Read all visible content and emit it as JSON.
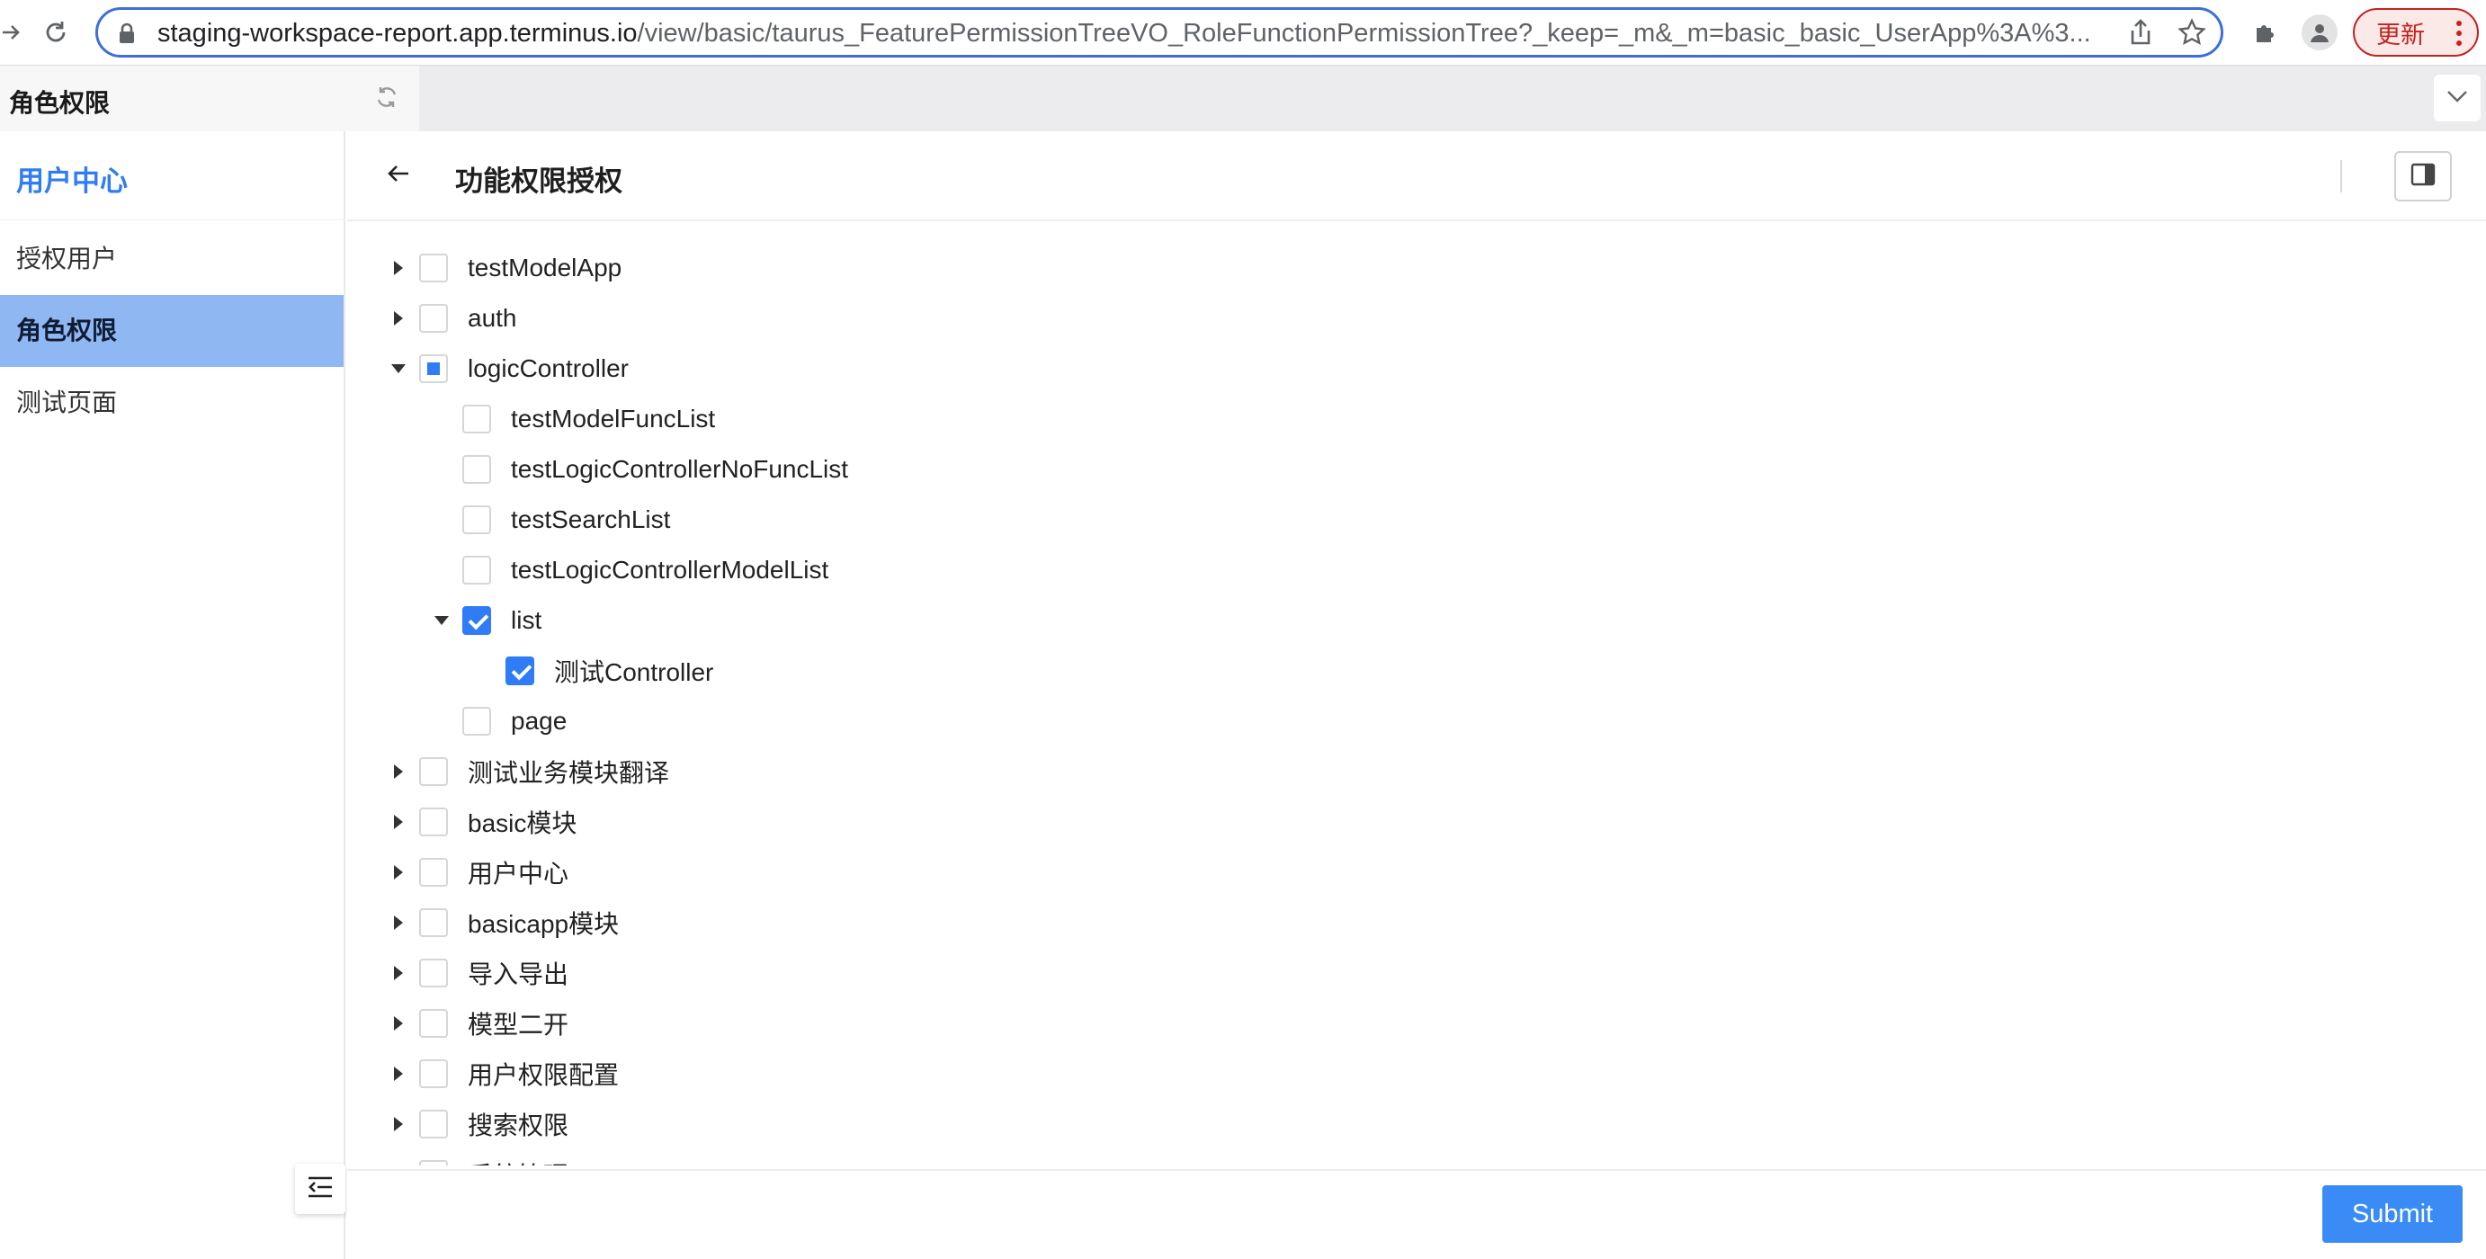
{
  "browser": {
    "url_host": "staging-workspace-report.app.terminus.io",
    "url_path": "/view/basic/taurus_FeaturePermissionTreeVO_RoleFunctionPermissionTree?_keep=_m&_m=basic_basic_UserApp%3A%3...",
    "update_label": "更新"
  },
  "tab": {
    "title": "角色权限"
  },
  "sidebar": {
    "title": "用户中心",
    "items": [
      {
        "label": "授权用户",
        "active": false
      },
      {
        "label": "角色权限",
        "active": true
      },
      {
        "label": "测试页面",
        "active": false
      }
    ]
  },
  "page": {
    "title": "功能权限授权"
  },
  "tree": [
    {
      "label": "testModelApp",
      "level": 0,
      "expand": "collapsed",
      "check": "none"
    },
    {
      "label": "auth",
      "level": 0,
      "expand": "collapsed",
      "check": "none"
    },
    {
      "label": "logicController",
      "level": 0,
      "expand": "expanded",
      "check": "half"
    },
    {
      "label": "testModelFuncList",
      "level": 1,
      "expand": "leaf",
      "check": "none"
    },
    {
      "label": "testLogicControllerNoFuncList",
      "level": 1,
      "expand": "leaf",
      "check": "none"
    },
    {
      "label": "testSearchList",
      "level": 1,
      "expand": "leaf",
      "check": "none"
    },
    {
      "label": "testLogicControllerModelList",
      "level": 1,
      "expand": "leaf",
      "check": "none"
    },
    {
      "label": "list",
      "level": 1,
      "expand": "expanded",
      "check": "checked"
    },
    {
      "label": "测试Controller",
      "level": 2,
      "expand": "leaf",
      "check": "checked"
    },
    {
      "label": "page",
      "level": 1,
      "expand": "leaf",
      "check": "none"
    },
    {
      "label": "测试业务模块翻译",
      "level": 0,
      "expand": "collapsed",
      "check": "none"
    },
    {
      "label": "basic模块",
      "level": 0,
      "expand": "collapsed",
      "check": "none"
    },
    {
      "label": "用户中心",
      "level": 0,
      "expand": "collapsed",
      "check": "none"
    },
    {
      "label": "basicapp模块",
      "level": 0,
      "expand": "collapsed",
      "check": "none"
    },
    {
      "label": "导入导出",
      "level": 0,
      "expand": "collapsed",
      "check": "none"
    },
    {
      "label": "模型二开",
      "level": 0,
      "expand": "collapsed",
      "check": "none"
    },
    {
      "label": "用户权限配置",
      "level": 0,
      "expand": "collapsed",
      "check": "none"
    },
    {
      "label": "搜索权限",
      "level": 0,
      "expand": "collapsed",
      "check": "none"
    },
    {
      "label": "系统管理",
      "level": 0,
      "expand": "collapsed",
      "check": "none"
    }
  ],
  "footer": {
    "submit_label": "Submit"
  },
  "colors": {
    "accent": "#2f7cf6",
    "active_bg": "#8fb7f2",
    "update_red": "#c5221f"
  }
}
